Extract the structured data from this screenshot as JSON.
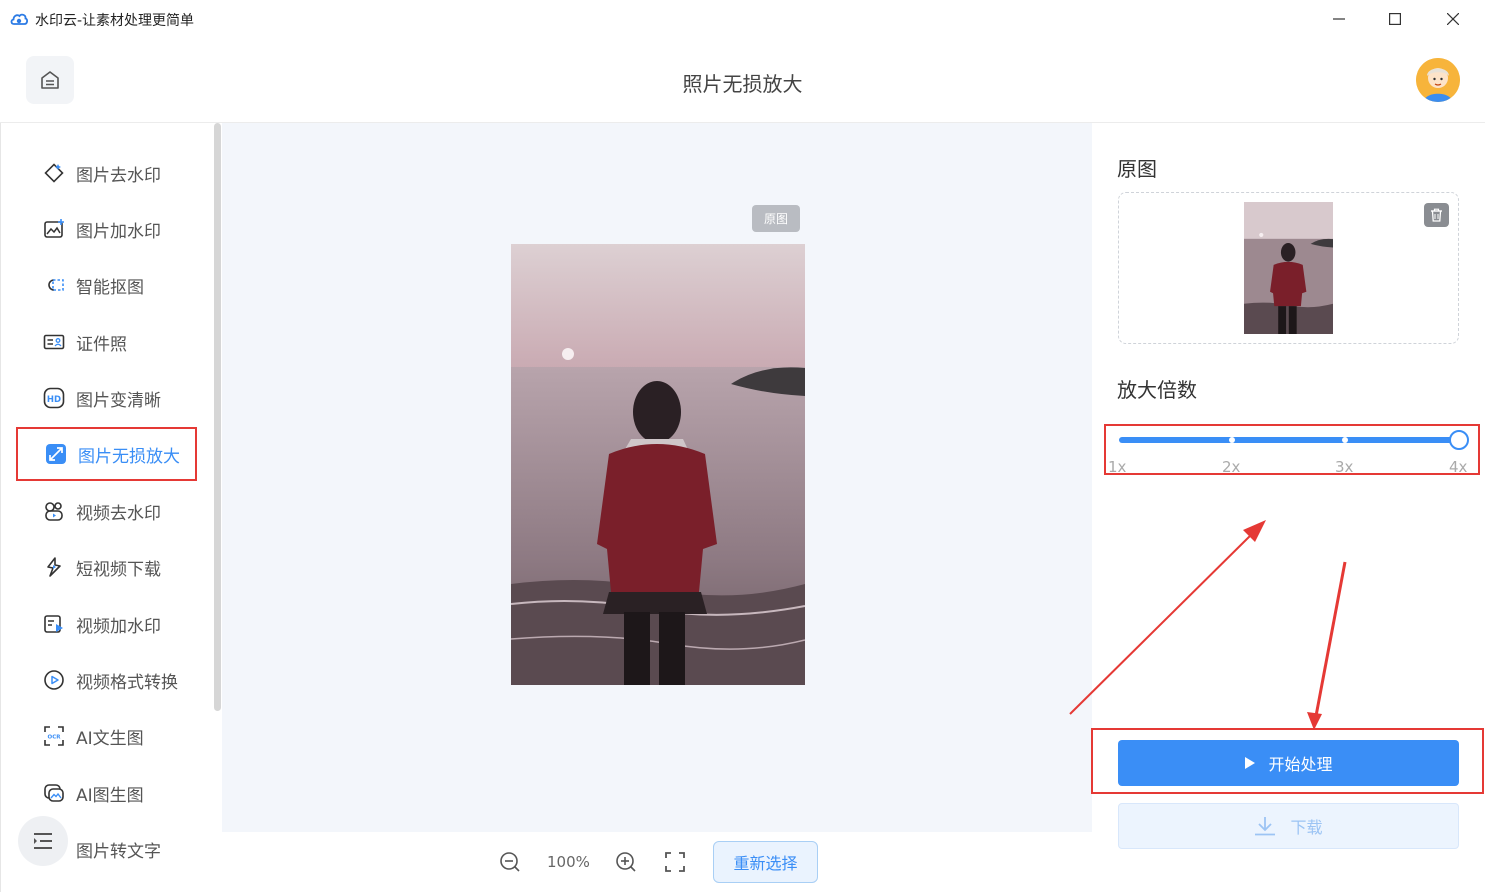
{
  "window": {
    "title": "水印云-让素材处理更简单"
  },
  "header": {
    "title": "照片无损放大"
  },
  "sidebar": {
    "items": [
      {
        "label": "图片去水印",
        "icon": "eraser-icon"
      },
      {
        "label": "图片加水印",
        "icon": "image-add-icon"
      },
      {
        "label": "智能抠图",
        "icon": "cutout-icon"
      },
      {
        "label": "证件照",
        "icon": "id-card-icon"
      },
      {
        "label": "图片变清晰",
        "icon": "hd-icon"
      },
      {
        "label": "图片无损放大",
        "icon": "enlarge-icon"
      },
      {
        "label": "视频去水印",
        "icon": "video-eraser-icon"
      },
      {
        "label": "短视频下载",
        "icon": "short-video-icon"
      },
      {
        "label": "视频加水印",
        "icon": "video-add-icon"
      },
      {
        "label": "视频格式转换",
        "icon": "play-circle-icon"
      },
      {
        "label": "AI文生图",
        "icon": "ocr-icon"
      },
      {
        "label": "AI图生图",
        "icon": "ai-image-icon"
      },
      {
        "label": "图片转文字",
        "icon": "text-icon"
      }
    ],
    "active_index": 5
  },
  "canvas": {
    "tag": "原图",
    "zoom": "100%",
    "reselect_label": "重新选择"
  },
  "right_panel": {
    "original_title": "原图",
    "scale_title": "放大倍数",
    "scale_ticks": [
      "1x",
      "2x",
      "3x",
      "4x"
    ],
    "scale_value": "4x",
    "start_label": "开始处理",
    "download_label": "下载"
  },
  "colors": {
    "accent": "#3a8ef6",
    "highlight": "#e53935"
  }
}
